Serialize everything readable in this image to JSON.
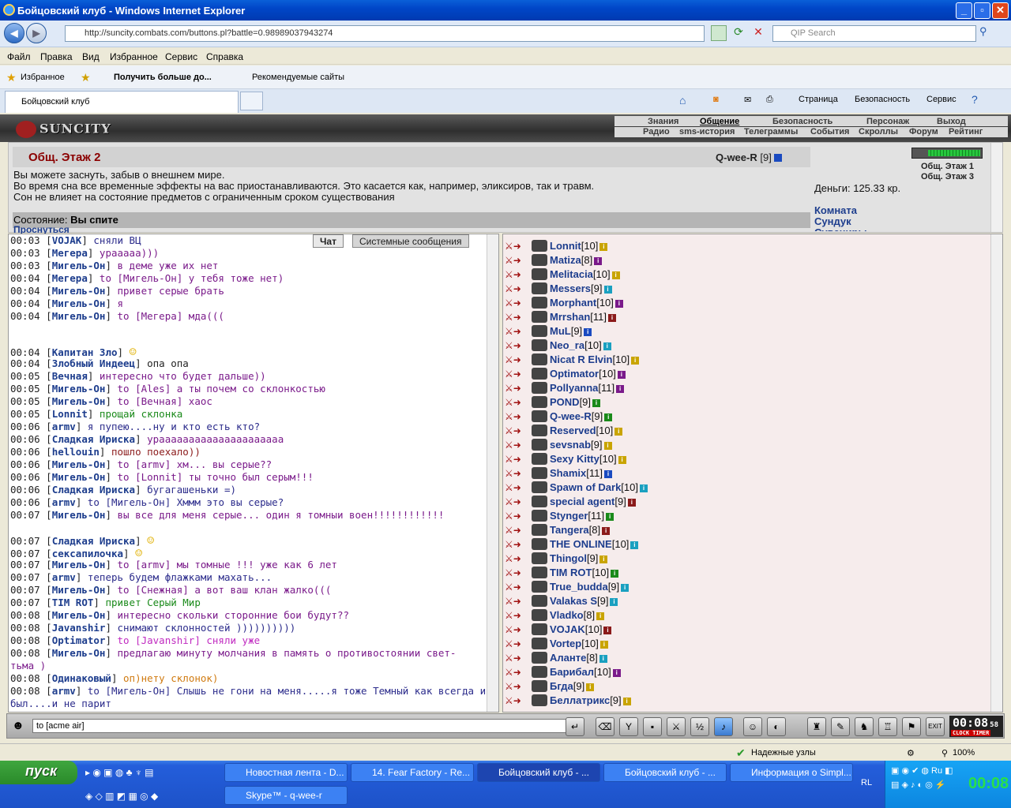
{
  "window": {
    "title": "Бойцовский клуб - Windows Internet Explorer"
  },
  "address": {
    "url": "http://suncity.combats.com/buttons.pl?battle=0.98989037943274",
    "search_placeholder": "QIP Search"
  },
  "menu": [
    "Файл",
    "Правка",
    "Вид",
    "Избранное",
    "Сервис",
    "Справка"
  ],
  "favorites": {
    "fav": "Избранное",
    "get_more": "Получить больше до...",
    "recommended": "Рекомендуемые сайты"
  },
  "tab": {
    "label": "Бойцовский клуб"
  },
  "toolbar": {
    "page": "Страница",
    "security": "Безопасность",
    "service": "Сервис"
  },
  "game": {
    "logo": "SUNCITY",
    "nav1": [
      "Знания",
      "Общение",
      "Безопасность",
      "Персонаж",
      "Выход"
    ],
    "nav2": [
      "Радио",
      "sms-история",
      "Телеграммы",
      "События",
      "Скроллы",
      "Форум",
      "Рейтинг"
    ]
  },
  "room": {
    "title": "Общ. Этаж 2",
    "me": "Q-wee-R",
    "me_level": "[9]",
    "line1": "Вы можете заснуть, забыв о внешнем мире.",
    "line2": "Во время сна все временные эффекты на вас приостанавливаются. Это касается как, например, эликсиров, так и травм.",
    "line3": "Сон не влияет на состояние предметов с ограниченным сроком существования",
    "state_label": "Состояние:",
    "state_value": "Вы спите",
    "wake": "Проснуться",
    "money": "Деньги: 125.33 кр.",
    "links": [
      "Комната",
      "Сундук",
      "Сувениры"
    ],
    "floors": [
      "Общ. Этаж 1",
      "Общ. Этаж 3"
    ]
  },
  "chat_tabs": [
    "Чат",
    "Системные сообщения"
  ],
  "chat": [
    {
      "t": "00:03",
      "n": "VOJAK",
      "m": "сняли ВЦ",
      "c": "#2b2b8b"
    },
    {
      "t": "00:03",
      "n": "Мегера",
      "m": "урааааа)))",
      "c": "#7a1a8a"
    },
    {
      "t": "00:03",
      "n": "Мигель-Он",
      "m": "в деме уже их нет",
      "c": "#7a1a8a"
    },
    {
      "t": "00:04",
      "n": "Мегера",
      "m": "to [Мигель-Он] у тебя тоже нет)",
      "c": "#7a1a8a"
    },
    {
      "t": "00:04",
      "n": "Мигель-Он",
      "m": "привет серые брать",
      "c": "#7a1a8a"
    },
    {
      "t": "00:04",
      "n": "Мигель-Он",
      "m": "я",
      "c": "#7a1a8a"
    },
    {
      "t": "00:04",
      "n": "Мигель-Он",
      "m": "to [Мегера] мда(((",
      "c": "#7a1a8a"
    },
    {
      "t": "00:04",
      "n": "Капитан Зло",
      "m": "",
      "c": "#222"
    },
    {
      "t": "00:04",
      "n": "Злобный Индеец",
      "m": "опа опа",
      "c": "#222"
    },
    {
      "t": "00:05",
      "n": "Вечная",
      "m": "интересно что будет дальше))",
      "c": "#7a1a8a"
    },
    {
      "t": "00:05",
      "n": "Мигель-Он",
      "m": "to [Ales] а ты почем со склонкостью",
      "c": "#7a1a8a"
    },
    {
      "t": "00:05",
      "n": "Мигель-Он",
      "m": "to [Вечная] хаос",
      "c": "#7a1a8a"
    },
    {
      "t": "00:05",
      "n": "Lonnit",
      "m": "прощай склонка",
      "c": "#1a8a1a"
    },
    {
      "t": "00:06",
      "n": "armv",
      "m": "я пупею....ну и кто есть кто?",
      "c": "#2b2b8b"
    },
    {
      "t": "00:06",
      "n": "Сладкая Ириска",
      "m": "урааааааааааааааааааааа",
      "c": "#7a1a8a"
    },
    {
      "t": "00:06",
      "n": "hellouin",
      "m": "пошло поехало))",
      "c": "#8b1a1a"
    },
    {
      "t": "00:06",
      "n": "Мигель-Он",
      "m": "to [armv] хм... вы серые??",
      "c": "#7a1a8a"
    },
    {
      "t": "00:06",
      "n": "Мигель-Он",
      "m": "to [Lonnit] ты точно был серым!!!",
      "c": "#7a1a8a"
    },
    {
      "t": "00:06",
      "n": "Сладкая Ириска",
      "m": "бугагашеньки =)",
      "c": "#2b2b8b"
    },
    {
      "t": "00:06",
      "n": "armv",
      "m": "to [Мигель-Он] Хммм это вы серые?",
      "c": "#2b2b8b"
    },
    {
      "t": "00:07",
      "n": "Мигель-Он",
      "m": "вы все для меня серые... один я томныи воен!!!!!!!!!!!!",
      "c": "#7a1a8a"
    },
    {
      "t": "00:07",
      "n": "Сладкая Ириска",
      "m": "",
      "c": "#222"
    },
    {
      "t": "00:07",
      "n": "сексапилочка",
      "m": "",
      "c": "#222"
    },
    {
      "t": "00:07",
      "n": "Мигель-Он",
      "m": "to [armv] мы томные !!! уже как 6 лет",
      "c": "#7a1a8a"
    },
    {
      "t": "00:07",
      "n": "armv",
      "m": "теперь будем флажками махать...",
      "c": "#2b2b8b"
    },
    {
      "t": "00:07",
      "n": "Мигель-Он",
      "m": "to [Снежная] а вот ваш клан жалко(((",
      "c": "#7a1a8a"
    },
    {
      "t": "00:07",
      "n": "TIM ROT",
      "m": "привет Серый Мир",
      "c": "#1a8a1a"
    },
    {
      "t": "00:08",
      "n": "Мигель-Он",
      "m": "интересно скольки сторонние бои будут??",
      "c": "#7a1a8a"
    },
    {
      "t": "00:08",
      "n": "Javanshir",
      "m": "снимают склонностей ))))))))))",
      "c": "#2b2b8b"
    },
    {
      "t": "00:08",
      "n": "Optimator",
      "m": "to [Javanshir] сняли уже",
      "c": "#c02ac0"
    },
    {
      "t": "00:08",
      "n": "Мигель-Он",
      "m": "предлагаю минуту молчания в память о противостоянии свет-",
      "c": "#7a1a8a"
    },
    {
      "t": "",
      "n": "",
      "m": "тьма )",
      "c": "#7a1a8a"
    },
    {
      "t": "00:08",
      "n": "Одинаковый",
      "m": "оп)нету склонок)",
      "c": "#d07a10"
    },
    {
      "t": "00:08",
      "n": "armv",
      "m": "to [Мигель-Он] Слышь не гони на меня.....я тоже Темный как всегда и",
      "c": "#2b2b8b"
    },
    {
      "t": "",
      "n": "",
      "m": "был....и не парит",
      "c": "#2b2b8b"
    }
  ],
  "users": [
    {
      "n": "Lonnit",
      "l": "[10]",
      "ic": "#c9a400"
    },
    {
      "n": "Matiza",
      "l": "[8]",
      "ic": "#7a1a8a"
    },
    {
      "n": "Melitacia",
      "l": "[10]",
      "ic": "#c9a400"
    },
    {
      "n": "Messers",
      "l": "[9]",
      "ic": "#1aa0c0"
    },
    {
      "n": "Morphant",
      "l": "[10]",
      "ic": "#7a1a8a"
    },
    {
      "n": "Mrrshan",
      "l": "[11]",
      "ic": "#8b1a1a"
    },
    {
      "n": "MuL",
      "l": "[9]",
      "ic": "#1a4ac0"
    },
    {
      "n": "Neo_ra",
      "l": "[10]",
      "ic": "#1aa0c0"
    },
    {
      "n": "Nicat R Elvin",
      "l": "[10]",
      "ic": "#c9a400"
    },
    {
      "n": "Optimator",
      "l": "[10]",
      "ic": "#7a1a8a"
    },
    {
      "n": "Pollyanna",
      "l": "[11]",
      "ic": "#7a1a8a"
    },
    {
      "n": "POND",
      "l": "[9]",
      "ic": "#1a8a1a"
    },
    {
      "n": "Q-wee-R",
      "l": "[9]",
      "ic": "#1a8a1a"
    },
    {
      "n": "Reserved",
      "l": "[10]",
      "ic": "#c9a400"
    },
    {
      "n": "sevsnab",
      "l": "[9]",
      "ic": "#c9a400"
    },
    {
      "n": "Sexy Kitty",
      "l": "[10]",
      "ic": "#c9a400"
    },
    {
      "n": "Shamix",
      "l": "[11]",
      "ic": "#1a4ac0"
    },
    {
      "n": "Spawn of Dark",
      "l": "[10]",
      "ic": "#1aa0c0"
    },
    {
      "n": "special agent",
      "l": "[9]",
      "ic": "#8b1a1a"
    },
    {
      "n": "Stynger",
      "l": "[11]",
      "ic": "#1a8a1a"
    },
    {
      "n": "Tangera",
      "l": "[8]",
      "ic": "#8b1a1a"
    },
    {
      "n": "THE ONLINE",
      "l": "[10]",
      "ic": "#1aa0c0"
    },
    {
      "n": "Thingol",
      "l": "[9]",
      "ic": "#c9a400"
    },
    {
      "n": "TIM ROT",
      "l": "[10]",
      "ic": "#1a8a1a"
    },
    {
      "n": "True_budda",
      "l": "[9]",
      "ic": "#1aa0c0"
    },
    {
      "n": "Valakas S",
      "l": "[9]",
      "ic": "#1aa0c0"
    },
    {
      "n": "Vladko",
      "l": "[8]",
      "ic": "#c9a400"
    },
    {
      "n": "VOJAK",
      "l": "[10]",
      "ic": "#8b1a1a"
    },
    {
      "n": "Vortep",
      "l": "[10]",
      "ic": "#c9a400"
    },
    {
      "n": "Аланте",
      "l": "[8]",
      "ic": "#1aa0c0"
    },
    {
      "n": "Барибал",
      "l": "[10]",
      "ic": "#7a1a8a"
    },
    {
      "n": "Бгда",
      "l": "[9]",
      "ic": "#c9a400"
    },
    {
      "n": "Беллатрикс",
      "l": "[9]",
      "ic": "#c9a400"
    }
  ],
  "input": {
    "value": "to [acme air]"
  },
  "clock": {
    "time": "00:08",
    "sec": "58",
    "label": "CLOCK TIMER"
  },
  "statusbar": {
    "trusted": "Надежные узлы",
    "zoom": "100%"
  },
  "taskbar": {
    "start": "пуск",
    "tasks": [
      "Новостная лента - D...",
      "14. Fear Factory - Re...",
      "Бойцовский клуб - ...",
      "Бойцовский клуб - ...",
      "Информация о Simpl...",
      "Skype™ - q-wee-r"
    ],
    "lang": "RL",
    "time": "00:08"
  }
}
